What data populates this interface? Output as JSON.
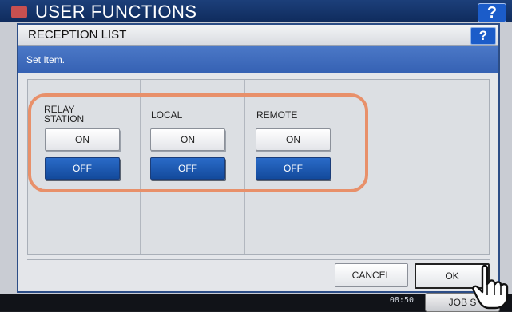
{
  "background": {
    "title": "USER FUNCTIONS",
    "help_label": "?",
    "time": "08:50",
    "job_status_label": "JOB S"
  },
  "dialog": {
    "title": "RECEPTION LIST",
    "help_label": "?",
    "instruction": "Set Item."
  },
  "columns": [
    {
      "label_line1": "RELAY",
      "label_line2": "STATION",
      "on_label": "ON",
      "off_label": "OFF",
      "selected": "OFF"
    },
    {
      "label_line1": "LOCAL",
      "label_line2": "",
      "on_label": "ON",
      "off_label": "OFF",
      "selected": "OFF"
    },
    {
      "label_line1": "REMOTE",
      "label_line2": "",
      "on_label": "ON",
      "off_label": "OFF",
      "selected": "OFF"
    }
  ],
  "footer": {
    "cancel_label": "CANCEL",
    "ok_label": "OK"
  },
  "colors": {
    "selected_button": "#1a56b0",
    "highlight_outline": "#e8906a",
    "instruction_bar": "#3d69b9"
  },
  "icons": {
    "pointer": "hand-pointer-icon",
    "app": "user-functions-icon"
  }
}
